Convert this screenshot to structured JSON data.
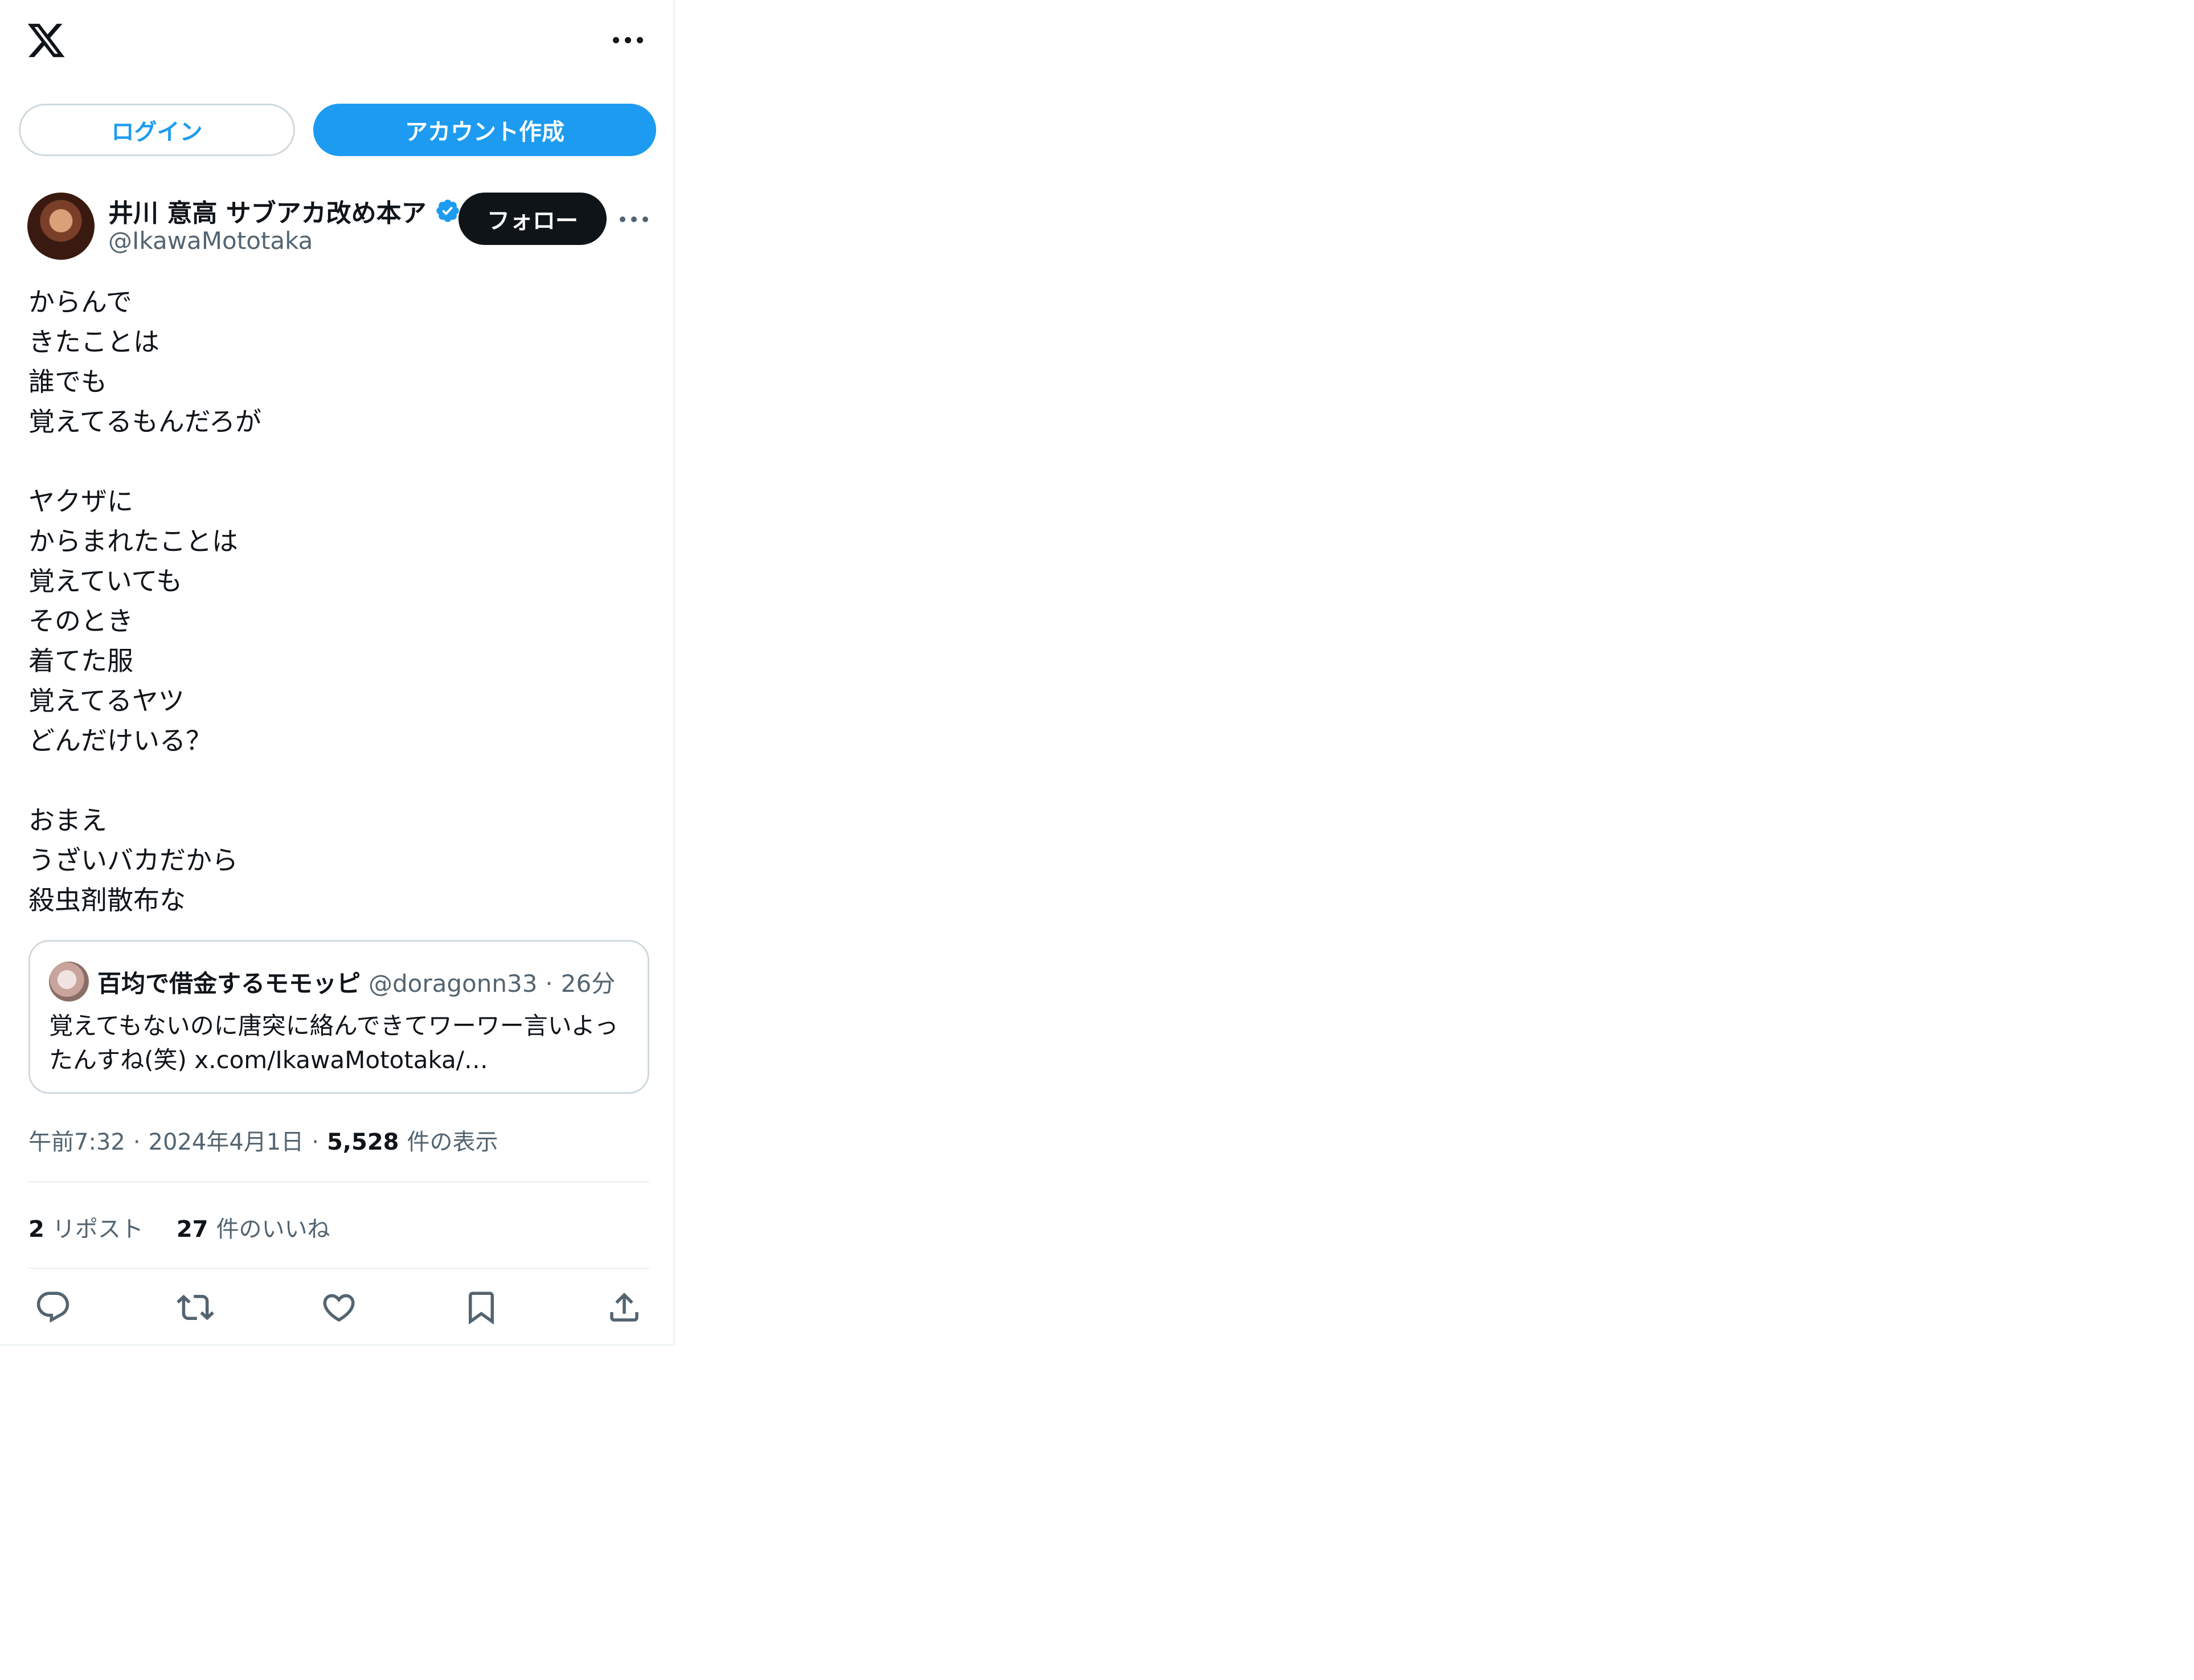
{
  "app": {
    "logo_icon": "x-logo-icon",
    "menu_icon": "more-horizontal-icon"
  },
  "auth": {
    "login_label": "ログイン",
    "signup_label": "アカウント作成"
  },
  "tweet": {
    "author": {
      "name": "井川 意高 サブアカ改め本ア",
      "handle": "@IkawaMototaka",
      "verified": true,
      "verified_icon": "verified-badge-icon"
    },
    "follow_label": "フォロー",
    "text": "からんで\nきたことは\n誰でも\n覚えてるもんだろが\n\nヤクザに\nからまれたことは\n覚えていても\nそのとき\n着てた服\n覚えてるヤツ\nどんだけいる？\n\nおまえ\nうざいバカだから\n殺虫剤散布な",
    "quote": {
      "name": "百均で借金するモモッピ",
      "handle": "@doragonn33",
      "separator": "·",
      "time": "26分",
      "text": "覚えてもないのに唐突に絡んできてワーワー言いよったんすね(笑) x.com/IkawaMototaka/…"
    },
    "meta": {
      "time": "午前7:32",
      "separator": "·",
      "date": "2024年4月1日",
      "separator2": "·",
      "views_count": "5,528",
      "views_label": "件の表示"
    },
    "stats": {
      "reposts_count": "2",
      "reposts_label": "リポスト",
      "likes_count": "27",
      "likes_label": "件のいいね"
    },
    "actions": [
      {
        "name": "reply",
        "icon": "reply-icon"
      },
      {
        "name": "repost",
        "icon": "repost-icon"
      },
      {
        "name": "like",
        "icon": "heart-icon"
      },
      {
        "name": "bookmark",
        "icon": "bookmark-icon"
      },
      {
        "name": "share",
        "icon": "share-icon"
      }
    ]
  },
  "colors": {
    "accent": "#1d9bf0",
    "text": "#0f1419",
    "muted": "#536471",
    "border": "#cfd9de",
    "divider": "#eff3f4"
  }
}
